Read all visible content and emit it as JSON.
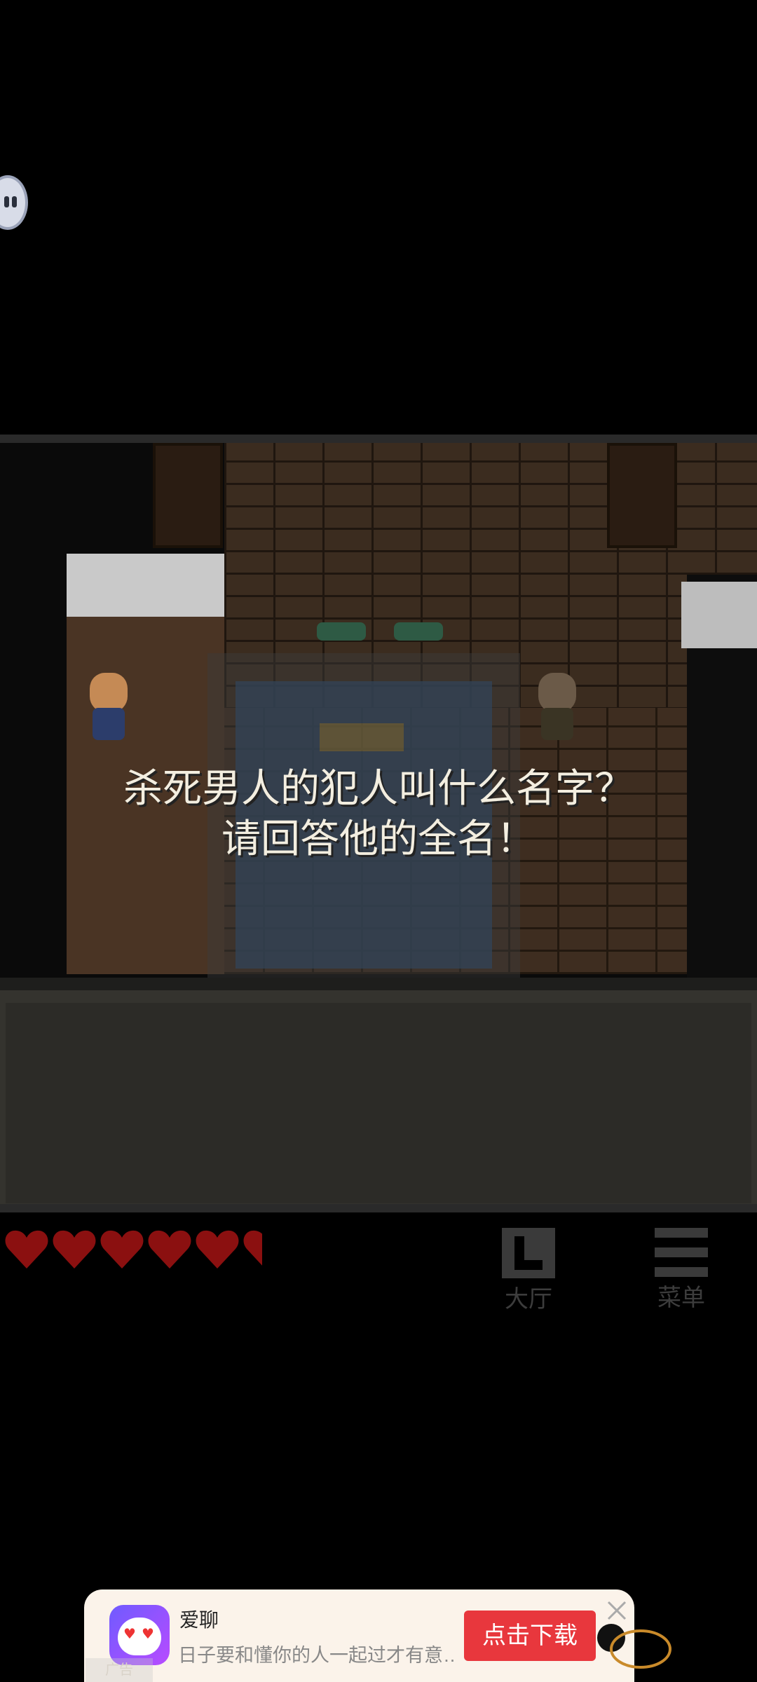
{
  "game": {
    "dialog_line1": "杀死男人的犯人叫什么名字？",
    "dialog_line2": "请回答他的全名！"
  },
  "hud": {
    "hearts_full": 5,
    "hearts_partial": 1,
    "heart_color": "#8b1010",
    "hall_label": "大厅",
    "menu_label": "菜单"
  },
  "ad": {
    "app_name": "爱聊",
    "description": "日子要和懂你的人一起过才有意…",
    "download_label": "点击下载",
    "tag_label": "广告",
    "download_color": "#e8373d"
  },
  "icons": [
    "floating-assistant-icon",
    "heart-icon",
    "hall-icon",
    "menu-icon",
    "app-cat-icon",
    "close-icon",
    "lasso-badge-icon"
  ]
}
